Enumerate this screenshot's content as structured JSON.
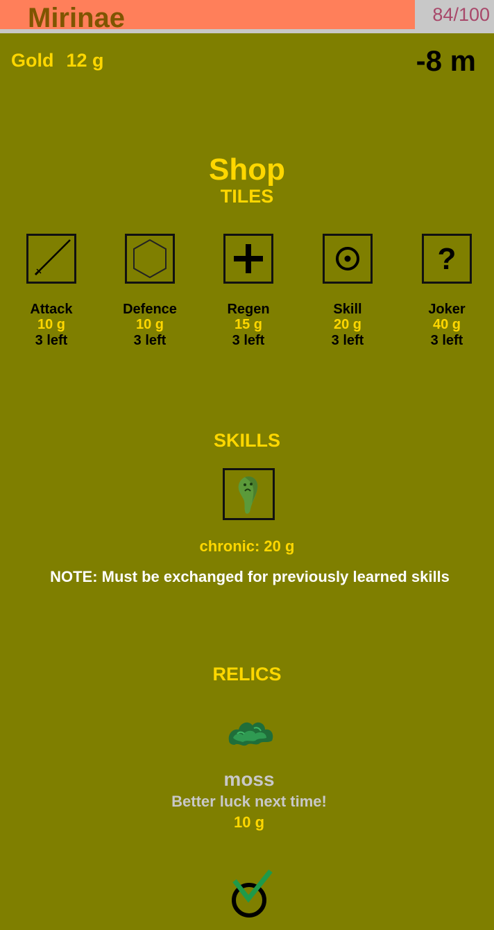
{
  "header": {
    "player_name": "Mirinae",
    "hp_text": "84/100",
    "hp_fraction": 0.84,
    "gold_label": "Gold",
    "gold_value": "12 g",
    "depth": "-8 m"
  },
  "shop": {
    "title": "Shop",
    "tiles_heading": "TILES",
    "tiles": [
      {
        "name": "Attack",
        "price": "10 g",
        "left": "3 left",
        "icon": "sword-icon"
      },
      {
        "name": "Defence",
        "price": "10 g",
        "left": "3 left",
        "icon": "hexagon-shield-icon"
      },
      {
        "name": "Regen",
        "price": "15 g",
        "left": "3 left",
        "icon": "plus-icon"
      },
      {
        "name": "Skill",
        "price": "20 g",
        "left": "3 left",
        "icon": "target-icon"
      },
      {
        "name": "Joker",
        "price": "40 g",
        "left": "3 left",
        "icon": "question-icon"
      }
    ],
    "skills_heading": "SKILLS",
    "skill": {
      "icon": "ghost-skill-icon",
      "price_text": "chronic: 20 g"
    },
    "note": "NOTE: Must be exchanged for previously learned skills",
    "relics_heading": "RELICS",
    "relic": {
      "icon": "moss-relic-icon",
      "name": "moss",
      "description": "Better luck next time!",
      "price": "10 g"
    },
    "confirm_icon": "checkmark-confirm-icon"
  },
  "colors": {
    "background": "#7f7f00",
    "gold": "#ffd700",
    "hp_bar": "#ff7f5a",
    "hp_bar_empty": "#c8c8c8"
  }
}
